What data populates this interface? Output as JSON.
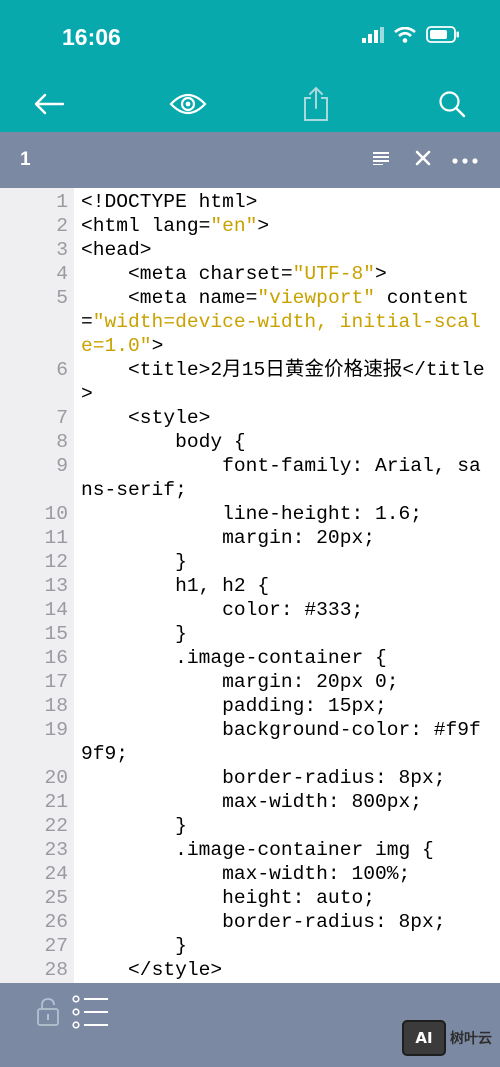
{
  "status": {
    "time": "16:06"
  },
  "icons": {
    "back": "arrow-left-icon",
    "preview": "eye-icon",
    "share": "share-icon",
    "search": "search-icon",
    "list": "list-icon",
    "close": "close-icon",
    "more": "more-icon",
    "lock": "lock-icon",
    "outline": "outline-list-icon"
  },
  "colors": {
    "accent": "#07a9ad",
    "bar": "#7b8aa2",
    "string": "#c9a200"
  },
  "tab": {
    "name": "1"
  },
  "code": [
    {
      "num": "1",
      "parts": [
        {
          "t": "<!DOCTYPE html>"
        }
      ]
    },
    {
      "num": "2",
      "parts": [
        {
          "t": "<html lang="
        },
        {
          "t": "\"en\"",
          "s": true
        },
        {
          "t": ">"
        }
      ]
    },
    {
      "num": "3",
      "parts": [
        {
          "t": "<head>"
        }
      ]
    },
    {
      "num": "4",
      "parts": [
        {
          "t": "    <meta charset="
        },
        {
          "t": "\"UTF-8\"",
          "s": true
        },
        {
          "t": ">"
        }
      ]
    },
    {
      "num": "5",
      "parts": [
        {
          "t": "    <meta name="
        },
        {
          "t": "\"viewport\"",
          "s": true
        },
        {
          "t": " content="
        },
        {
          "t": "\"width=device-width, initial-scale=1.0\"",
          "s": true
        },
        {
          "t": ">"
        }
      ]
    },
    {
      "num": "6",
      "parts": [
        {
          "t": "    <title>2月15日黄金价格速报</title>"
        }
      ]
    },
    {
      "num": "7",
      "parts": [
        {
          "t": "    <style>"
        }
      ]
    },
    {
      "num": "8",
      "parts": [
        {
          "t": "        body {"
        }
      ]
    },
    {
      "num": "9",
      "parts": [
        {
          "t": "            font-family: Arial, sans-serif;"
        }
      ]
    },
    {
      "num": "10",
      "parts": [
        {
          "t": "            line-height: 1.6;"
        }
      ]
    },
    {
      "num": "11",
      "parts": [
        {
          "t": "            margin: 20px;"
        }
      ]
    },
    {
      "num": "12",
      "parts": [
        {
          "t": "        }"
        }
      ]
    },
    {
      "num": "13",
      "parts": [
        {
          "t": "        h1, h2 {"
        }
      ]
    },
    {
      "num": "14",
      "parts": [
        {
          "t": "            color: #333;"
        }
      ]
    },
    {
      "num": "15",
      "parts": [
        {
          "t": "        }"
        }
      ]
    },
    {
      "num": "16",
      "parts": [
        {
          "t": "        .image-container {"
        }
      ]
    },
    {
      "num": "17",
      "parts": [
        {
          "t": "            margin: 20px 0;"
        }
      ]
    },
    {
      "num": "18",
      "parts": [
        {
          "t": "            padding: 15px;"
        }
      ]
    },
    {
      "num": "19",
      "parts": [
        {
          "t": "            background-color: #f9f9f9;"
        }
      ]
    },
    {
      "num": "20",
      "parts": [
        {
          "t": "            border-radius: 8px;"
        }
      ]
    },
    {
      "num": "21",
      "parts": [
        {
          "t": "            max-width: 800px;"
        }
      ]
    },
    {
      "num": "22",
      "parts": [
        {
          "t": "        }"
        }
      ]
    },
    {
      "num": "23",
      "parts": [
        {
          "t": "        .image-container img {"
        }
      ]
    },
    {
      "num": "24",
      "parts": [
        {
          "t": "            max-width: 100%;"
        }
      ]
    },
    {
      "num": "25",
      "parts": [
        {
          "t": "            height: auto;"
        }
      ]
    },
    {
      "num": "26",
      "parts": [
        {
          "t": "            border-radius: 8px;"
        }
      ]
    },
    {
      "num": "27",
      "parts": [
        {
          "t": "        }"
        }
      ]
    },
    {
      "num": "28",
      "parts": [
        {
          "t": "    </style>"
        }
      ]
    }
  ],
  "watermark": {
    "badge": "AI",
    "text": "树叶云"
  }
}
